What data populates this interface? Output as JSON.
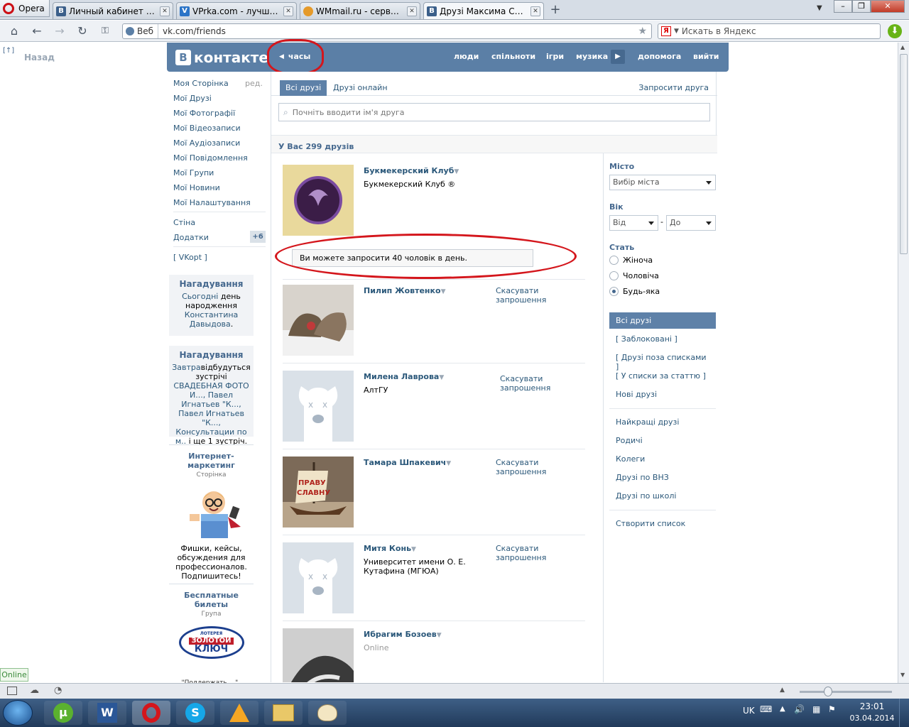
{
  "browser": {
    "menu_label": "Opera",
    "tabs": [
      {
        "title": "Личный кабинет - Ис...",
        "fav": "vk-icon"
      },
      {
        "title": "VPrka.com - лучшая б...",
        "fav": "v-icon"
      },
      {
        "title": "WMmail.ru - сервис п...",
        "fav": "wm-icon"
      },
      {
        "title": "Друзі Максима Степо...",
        "fav": "vk-icon"
      }
    ],
    "address_web": "Веб",
    "address_url": "vk.com/friends",
    "search_placeholder": "Искать в Яндекс",
    "back_label": "Назад",
    "back_icon_text": "[↑]"
  },
  "vk": {
    "logo": "контакте",
    "logo_b": "В",
    "chasy": "часы",
    "nav": [
      "люди",
      "спільноти",
      "ігри",
      "музика",
      "допомога",
      "вийти"
    ],
    "left_menu": [
      "Моя Сторінка",
      "Мої Друзі",
      "Мої Фотографії",
      "Мої Відеозаписи",
      "Мої Аудіозаписи",
      "Мої Повідомлення",
      "Мої Групи",
      "Мої Новини",
      "Мої Налаштування"
    ],
    "edit": "ред.",
    "wall": "Стіна",
    "apps": "Додатки",
    "apps_badge": "+6",
    "vkopt": "[ VKopt ]",
    "reminder1": {
      "title": "Нагадування",
      "link1": "Сьогодні",
      "text1": " день народження ",
      "link2": "Константина Давыдова",
      "text2": "."
    },
    "reminder2": {
      "title": "Нагадування",
      "link1": "Завтра",
      "text1": "відбудуться зустрічі ",
      "link2": "СВАДЕБНАЯ ФОТО И..., Павел Игнатьев \"К..., Павел Игнатьев \"К..., Консультации по м..",
      "text2": " і ще 1 зустріч."
    },
    "ad1": {
      "title": "Интернет-маркетинг",
      "type": "Сторінка",
      "text": "Фишки, кейсы, обсуждения для профессионалов. Подпишитесь!"
    },
    "ad2": {
      "title": "Бесплатные билеты",
      "type": "Група",
      "logo_top": "ЛОТЕРЕЯ",
      "logo_mid": "ЗОЛОТОЙ",
      "logo_bot": "КЛЮЧ"
    },
    "online_badge": "Online",
    "cut_text": "... \"Поддержать ...\""
  },
  "friends": {
    "tab_all": "Всі друзі",
    "tab_online": "Друзі онлайн",
    "invite": "Запросити друга",
    "search_placeholder": "Почніть вводити ім'я друга",
    "count": "У Вас 299 друзів",
    "limit_msg": "Ви можете запросити 40 чоловік в день.",
    "rows": [
      {
        "name": "Букмекерский Клуб",
        "sub": "Букмекерский Клуб ®",
        "action": ""
      },
      {
        "name": "Пилип Жовтенко",
        "sub": "",
        "action": "Скасувати запрошення"
      },
      {
        "name": "Милена Лаврова",
        "sub": "АлтГУ",
        "action": "Скасувати запрошення"
      },
      {
        "name": "Тамара Шпакевич",
        "sub": "",
        "action": "Скасувати запрошення"
      },
      {
        "name": "Митя Конь",
        "sub": "Университет имени О. Е. Кутафина (МГЮА)",
        "action": "Скасувати запрошення"
      },
      {
        "name": "Ибрагим Бозоев",
        "sub": "Online",
        "action": ""
      }
    ]
  },
  "filters": {
    "city_label": "Місто",
    "city_value": "Вибір міста",
    "age_label": "Вік",
    "age_from": "Від",
    "age_to": "До",
    "age_dash": "-",
    "gender_label": "Стать",
    "genders": [
      "Жіноча",
      "Чоловіча",
      "Будь-яка"
    ],
    "lists1": [
      "Всі друзі",
      "[ Заблоковані ]",
      "[ Друзі поза списками ]",
      "[ У списки за статтю ]",
      "Нові друзі"
    ],
    "lists2": [
      "Найкращі друзі",
      "Родичі",
      "Колеги",
      "Друзі по ВНЗ",
      "Друзі по школі"
    ],
    "create_list": "Створити список"
  },
  "taskbar": {
    "lang": "UK",
    "time": "23:01",
    "date": "03.04.2014"
  },
  "colors": {
    "vk_blue": "#5b7fa6",
    "link": "#2b587a",
    "annotation": "#d4161c"
  }
}
